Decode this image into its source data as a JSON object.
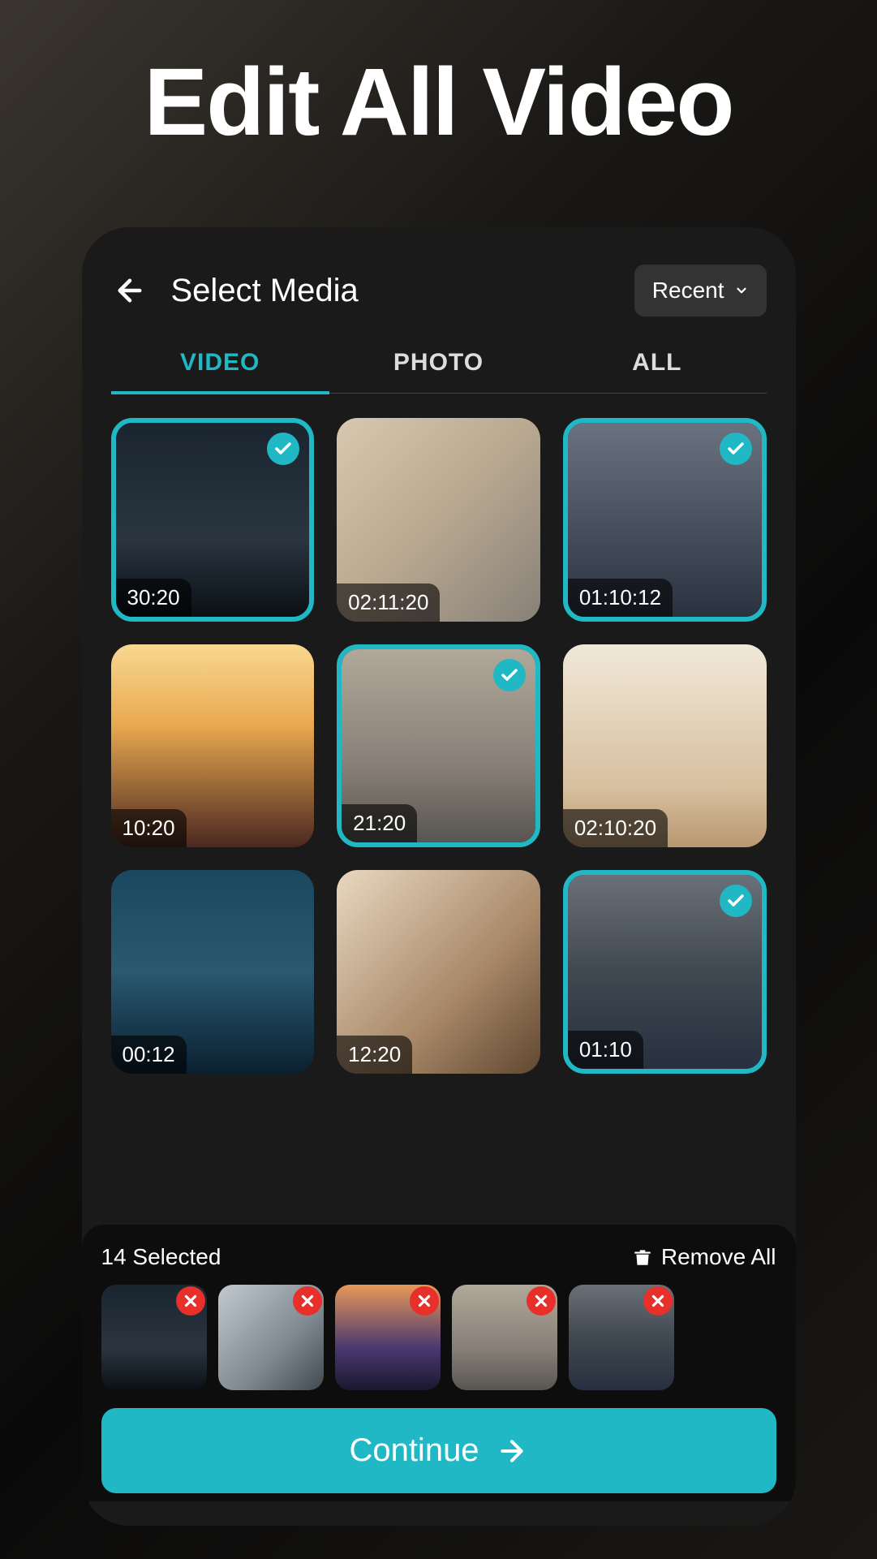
{
  "hero": {
    "title": "Edit All Video"
  },
  "header": {
    "title": "Select Media",
    "dropdown_label": "Recent"
  },
  "tabs": [
    {
      "label": "VIDEO",
      "active": true
    },
    {
      "label": "PHOTO",
      "active": false
    },
    {
      "label": "ALL",
      "active": false
    }
  ],
  "grid": [
    {
      "duration": "30:20",
      "selected": true,
      "bg": "bg1"
    },
    {
      "duration": "02:11:20",
      "selected": false,
      "bg": "bg2"
    },
    {
      "duration": "01:10:12",
      "selected": true,
      "bg": "bg3"
    },
    {
      "duration": "10:20",
      "selected": false,
      "bg": "bg4"
    },
    {
      "duration": "21:20",
      "selected": true,
      "bg": "bg5"
    },
    {
      "duration": "02:10:20",
      "selected": false,
      "bg": "bg6"
    },
    {
      "duration": "00:12",
      "selected": false,
      "bg": "bg7"
    },
    {
      "duration": "12:20",
      "selected": false,
      "bg": "bg8"
    },
    {
      "duration": "01:10",
      "selected": true,
      "bg": "bg9"
    }
  ],
  "panel": {
    "selected_text": "14 Selected",
    "remove_all_label": "Remove All",
    "items": [
      {
        "bg": "bg1"
      },
      {
        "bg": "bg-s2"
      },
      {
        "bg": "bg-s3"
      },
      {
        "bg": "bg5"
      },
      {
        "bg": "bg9"
      }
    ]
  },
  "continue_label": "Continue",
  "colors": {
    "accent": "#1fb8c4",
    "remove": "#e8302a"
  }
}
